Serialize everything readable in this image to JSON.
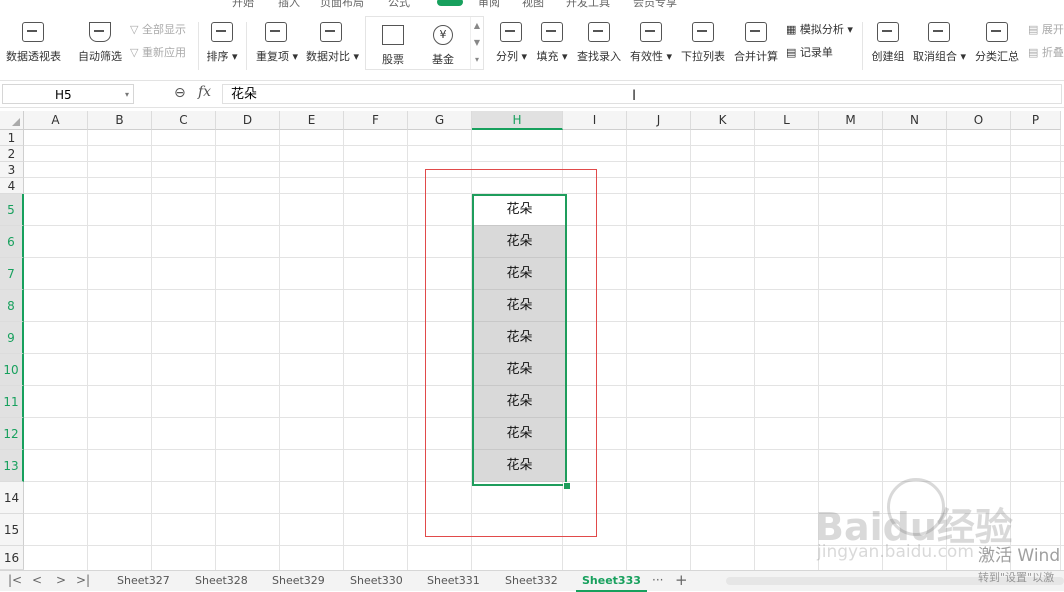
{
  "top_menu": [
    "开始",
    "插入",
    "页面布局",
    "公式",
    "数据",
    "审阅",
    "视图",
    "开发工具",
    "会员专享"
  ],
  "ribbon": {
    "pivot_table": "数据透视表",
    "auto_filter": "自动筛选",
    "show_all": "全部显示",
    "reapply": "重新应用",
    "sort": "排序",
    "duplicates": "重复项",
    "data_compare": "数据对比",
    "stocks": "股票",
    "funds": "基金",
    "split": "分列",
    "fill": "填充",
    "find_entry": "查找录入",
    "validity": "有效性",
    "dropdown_list": "下拉列表",
    "consolidate": "合并计算",
    "what_if": "模拟分析",
    "record_sheet": "记录单",
    "create_group": "创建组",
    "ungroup": "取消组合",
    "subtotal": "分类汇总",
    "expand": "展开",
    "collapse": "折叠"
  },
  "formula_bar": {
    "cell_ref": "H5",
    "fx": "fx",
    "value": "花朵"
  },
  "columns": [
    "A",
    "B",
    "C",
    "D",
    "E",
    "F",
    "G",
    "H",
    "I",
    "J",
    "K",
    "L",
    "M",
    "N",
    "O",
    "P"
  ],
  "rows": [
    "1",
    "2",
    "3",
    "4",
    "5",
    "6",
    "7",
    "8",
    "9",
    "10",
    "11",
    "12",
    "13",
    "14",
    "15",
    "16"
  ],
  "cells": {
    "H5": "花朵",
    "H6": "花朵",
    "H7": "花朵",
    "H8": "花朵",
    "H9": "花朵",
    "H10": "花朵",
    "H11": "花朵",
    "H12": "花朵",
    "H13": "花朵"
  },
  "selection": {
    "active": "H5",
    "range": "H5:H13"
  },
  "sheet_tabs": [
    "Sheet327",
    "Sheet328",
    "Sheet329",
    "Sheet330",
    "Sheet331",
    "Sheet332",
    "Sheet333"
  ],
  "active_sheet": "Sheet333",
  "watermark": {
    "brand": "Baidu经验",
    "url": "jingyan.baidu.com"
  },
  "activation": {
    "line1": "激活 Wind",
    "line2": "转到\"设置\"以激"
  },
  "colors": {
    "accent": "#17a05d",
    "annotation": "#e14a4a",
    "selected_fill": "#d9d9d9"
  }
}
